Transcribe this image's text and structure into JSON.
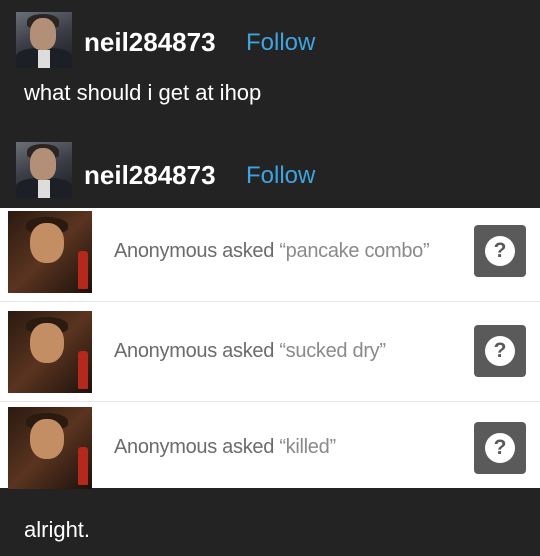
{
  "posts": [
    {
      "username": "neil284873",
      "follow_label": "Follow",
      "text": "what should i get at ihop"
    },
    {
      "username": "neil284873",
      "follow_label": "Follow"
    }
  ],
  "asks": [
    {
      "asker": "Anonymous asked",
      "question": "“pancake combo”",
      "icon": "question-mark-icon"
    },
    {
      "asker": "Anonymous asked",
      "question": "“sucked dry”",
      "icon": "question-mark-icon"
    },
    {
      "asker": "Anonymous asked",
      "question": "“killed”",
      "icon": "question-mark-icon"
    }
  ],
  "question_glyph": "?",
  "reply_text": "alright.",
  "colors": {
    "background": "#232323",
    "follow": "#3fa3e0",
    "ask_panel": "#ffffff",
    "ask_button": "#5a5a5a"
  }
}
